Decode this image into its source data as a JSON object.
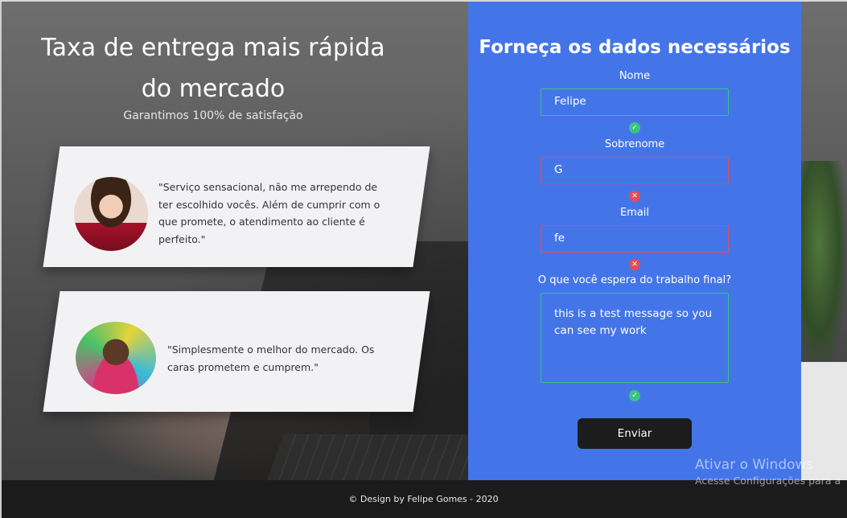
{
  "hero": {
    "title": "Taxa de entrega mais rápida do mercado",
    "subtitle": "Garantimos 100% de satisfação"
  },
  "testimonials": [
    {
      "quote": "\"Serviço sensacional, não me arrependo de ter escolhido vocês. Além de cumprir com o que promete, o atendimento ao cliente é perfeito.\""
    },
    {
      "quote": "\"Simplesmente o melhor do mercado. Os caras prometem e cumprem.\""
    }
  ],
  "form": {
    "title": "Forneça os dados necessários",
    "fields": [
      {
        "label": "Nome",
        "value": "Felipe",
        "status": "valid"
      },
      {
        "label": "Sobrenome",
        "value": "G",
        "status": "invalid"
      },
      {
        "label": "Email",
        "value": "fe",
        "status": "invalid"
      },
      {
        "label": "O que você espera do trabalho final?",
        "value": "this is a test message so you can see my work",
        "status": "valid"
      }
    ],
    "submit_label": "Enviar"
  },
  "footer": {
    "text": "© Design by Felipe Gomes - 2020"
  },
  "watermark": {
    "line1": "Ativar o Windows",
    "line2": "Acesse Configurações para a"
  },
  "colors": {
    "form_bg": "#4475e8",
    "valid": "#3ac483",
    "invalid": "#e04d5a",
    "button": "#1c1c1c"
  },
  "icons": {
    "valid": "check-circle-icon",
    "invalid": "x-circle-icon"
  }
}
